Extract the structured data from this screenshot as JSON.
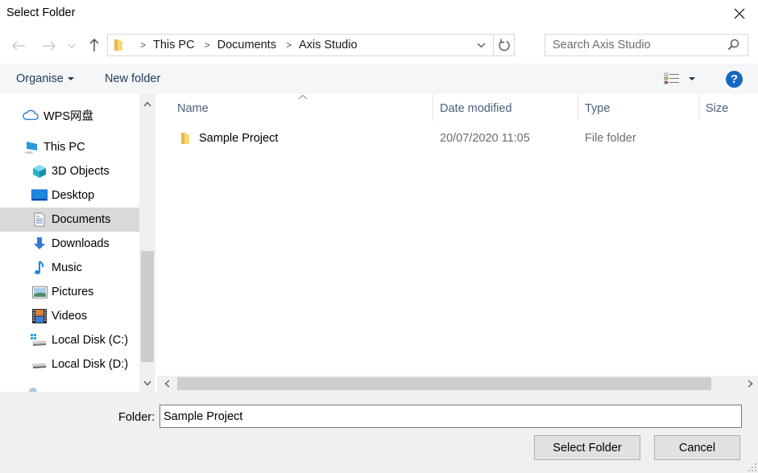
{
  "window": {
    "title": "Select Folder"
  },
  "navigation": {
    "back_icon": "arrow-left",
    "forward_icon": "arrow-right",
    "recent_icon": "chevron-down",
    "up_icon": "arrow-up",
    "breadcrumb": [
      "This PC",
      "Documents",
      "Axis Studio"
    ],
    "search_placeholder": "Search Axis Studio"
  },
  "toolbar": {
    "organise_label": "Organise",
    "new_folder_label": "New folder",
    "help_label": "?"
  },
  "sidebar": {
    "items": [
      {
        "label": "WPS网盘",
        "icon": "cloud-icon"
      },
      {
        "label": "This PC",
        "icon": "computer-icon"
      },
      {
        "label": "3D Objects",
        "icon": "cube-icon"
      },
      {
        "label": "Desktop",
        "icon": "desktop-icon"
      },
      {
        "label": "Documents",
        "icon": "document-icon",
        "selected": true
      },
      {
        "label": "Downloads",
        "icon": "download-icon"
      },
      {
        "label": "Music",
        "icon": "music-icon"
      },
      {
        "label": "Pictures",
        "icon": "picture-icon"
      },
      {
        "label": "Videos",
        "icon": "video-icon"
      },
      {
        "label": "Local Disk (C:)",
        "icon": "system-drive-icon"
      },
      {
        "label": "Local Disk (D:)",
        "icon": "drive-icon"
      }
    ]
  },
  "file_list": {
    "columns": [
      "Name",
      "Date modified",
      "Type",
      "Size"
    ],
    "rows": [
      {
        "name": "Sample Project",
        "date_modified": "20/07/2020 11:05",
        "type": "File folder",
        "size": ""
      }
    ]
  },
  "footer": {
    "folder_label": "Folder:",
    "folder_value": "Sample Project",
    "select_button": "Select Folder",
    "cancel_button": "Cancel"
  },
  "colors": {
    "accent_blue": "#1866c3",
    "selected_bg": "#d9d9d9",
    "toolbar_bg": "#f5f6f7",
    "footer_bg": "#f0f0f0",
    "header_text": "#4c607a",
    "folder_yellow": "#f8d775"
  }
}
